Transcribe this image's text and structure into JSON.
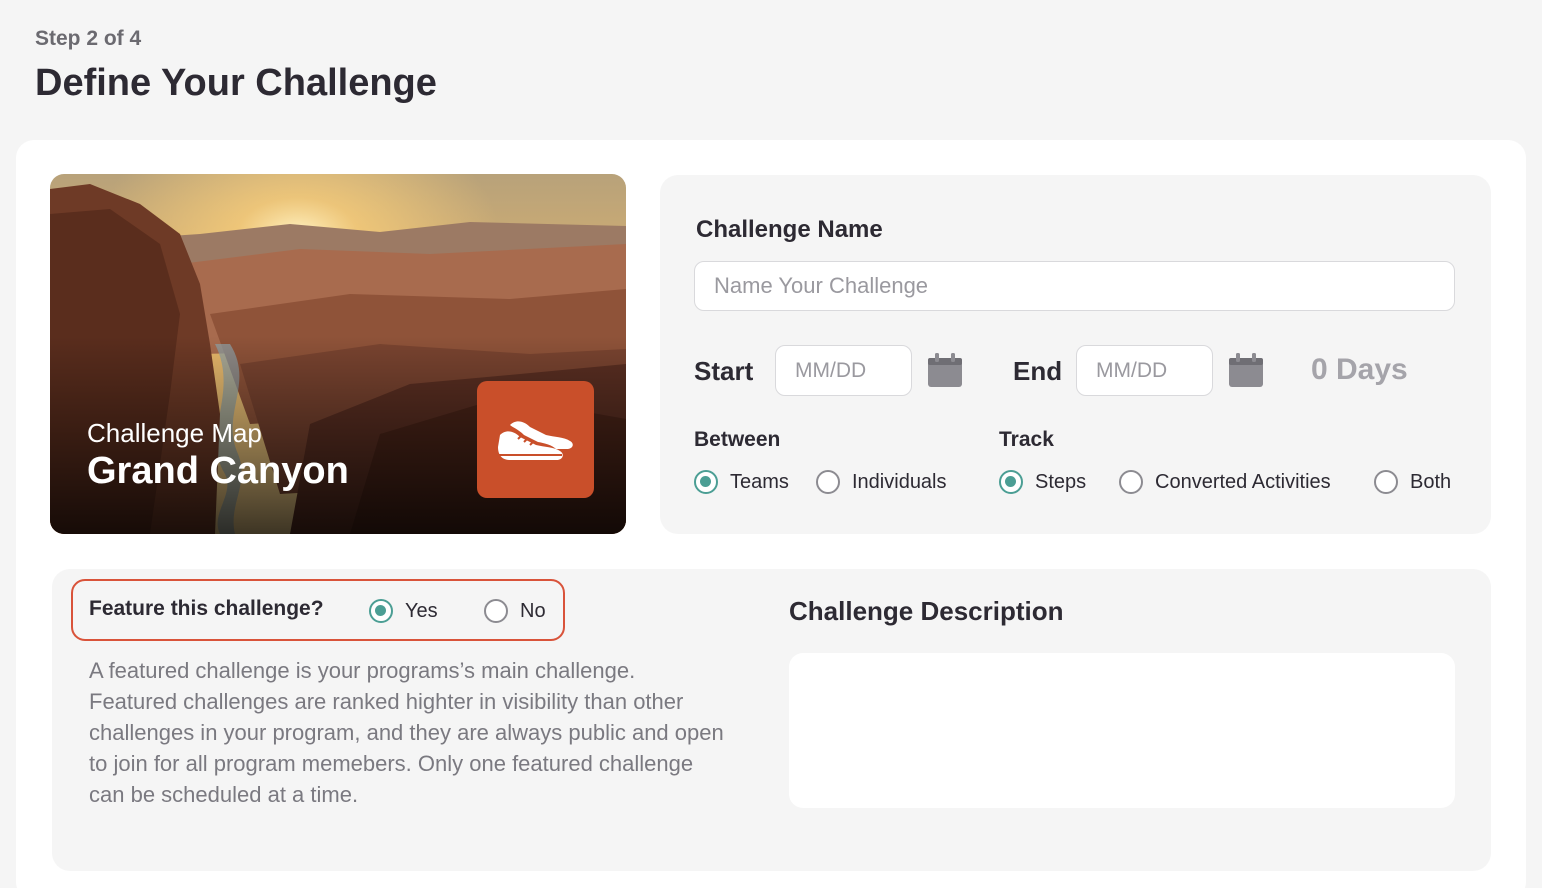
{
  "header": {
    "step": "Step 2 of 4",
    "title": "Define Your Challenge"
  },
  "map_card": {
    "subtitle": "Challenge Map",
    "name": "Grand Canyon",
    "badge_color": "#c94f2a",
    "badge_icon": "sneakers-icon"
  },
  "form": {
    "challenge_name_label": "Challenge Name",
    "challenge_name_placeholder": "Name Your Challenge",
    "challenge_name_value": "",
    "start_label": "Start",
    "start_placeholder": "MM/DD",
    "end_label": "End",
    "end_placeholder": "MM/DD",
    "days": "0 Days",
    "between_label": "Between",
    "between_options": [
      {
        "label": "Teams",
        "selected": true
      },
      {
        "label": "Individuals",
        "selected": false
      }
    ],
    "track_label": "Track",
    "track_options": [
      {
        "label": "Steps",
        "selected": true
      },
      {
        "label": "Converted Activities",
        "selected": false
      },
      {
        "label": "Both",
        "selected": false
      }
    ]
  },
  "feature": {
    "question": "Feature this challenge?",
    "options": [
      {
        "label": "Yes",
        "selected": true
      },
      {
        "label": "No",
        "selected": false
      }
    ],
    "help": "A featured challenge is your programs’s main challenge. Featured challenges are ranked highter in visibility than other challenges in your program, and they are always public and open to join for all program memebers. Only one featured challenge can be scheduled at a time.",
    "highlight_color": "#d9533a"
  },
  "description": {
    "title": "Challenge Description",
    "value": ""
  },
  "colors": {
    "accent": "#4b9e94",
    "text": "#2d2a33",
    "muted": "#7a7980"
  }
}
